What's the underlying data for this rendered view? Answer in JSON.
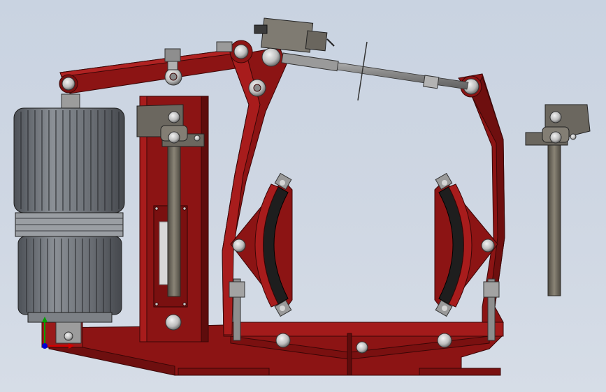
{
  "viewport": {
    "name": "cad-3d-viewport",
    "background_top": "#c9d3e1",
    "background_bottom": "#d6dde7"
  },
  "model": {
    "parts": [
      "electro-hydraulic-thruster",
      "base-frame",
      "left-brake-arm",
      "right-brake-arm",
      "top-lever",
      "adjusting-rod",
      "limit-switch",
      "left-brake-shoe",
      "right-brake-shoe",
      "spring-tube",
      "detached-spring-rod"
    ],
    "colors": {
      "frame_red": "#8c1414",
      "frame_red_light": "#a81c1c",
      "frame_red_dark": "#5e0c0c",
      "thruster_gray": "#6f7379",
      "steel_gray": "#8a8a8a",
      "rod_dark": "#6e685c",
      "lining_black": "#1e1e1e",
      "pin_light": "#d4d4d4"
    }
  },
  "triad": {
    "x_color": "#d40000",
    "y_color": "#00a000",
    "z_color": "#0000d4"
  }
}
